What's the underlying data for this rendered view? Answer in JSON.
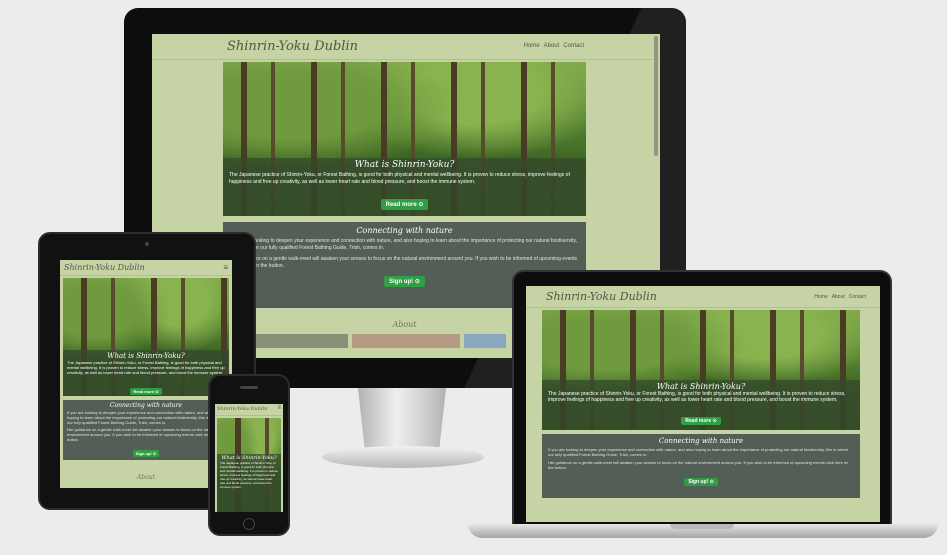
{
  "site": {
    "brand": "Shinrin-Yoku Dublin",
    "nav": [
      "Home",
      "About",
      "Contact"
    ],
    "hero_title": "What is Shinrin-Yoku?",
    "hero_text": "The Japanese practice of Shinrin-Yoku, or Forest Bathing, is good for both physical and mental wellbeing. It is proven to reduce stress, improve feelings of happiness and free up creativity, as well as lower heart rate and blood pressure, and boost the immune system.",
    "read_more": "Read more",
    "panel_title": "Connecting with nature",
    "panel_text_1": "If you are looking to deepen your experience and connection with nature, and also hoping to learn about the importance of protecting our natural biodiversity, this is where our fully qualified Forest Bathing Guide, Trish, comes in.",
    "panel_text_2": "Her guidance on a gentle walk-meet will awaken your senses to focus on the natural environment around you. If you wish to be informed of upcoming events click here on the button.",
    "signup": "Sign up!",
    "about_heading": "About"
  },
  "colors": {
    "page_bg": "#c6d3a4",
    "panel_bg": "#535f56",
    "button_bg": "#2f9e44",
    "brand_text": "#4c5a44"
  },
  "icons": {
    "read_more": "chevron-circle-down-icon",
    "signup": "chevron-circle-right-icon",
    "menu": "hamburger-icon"
  }
}
